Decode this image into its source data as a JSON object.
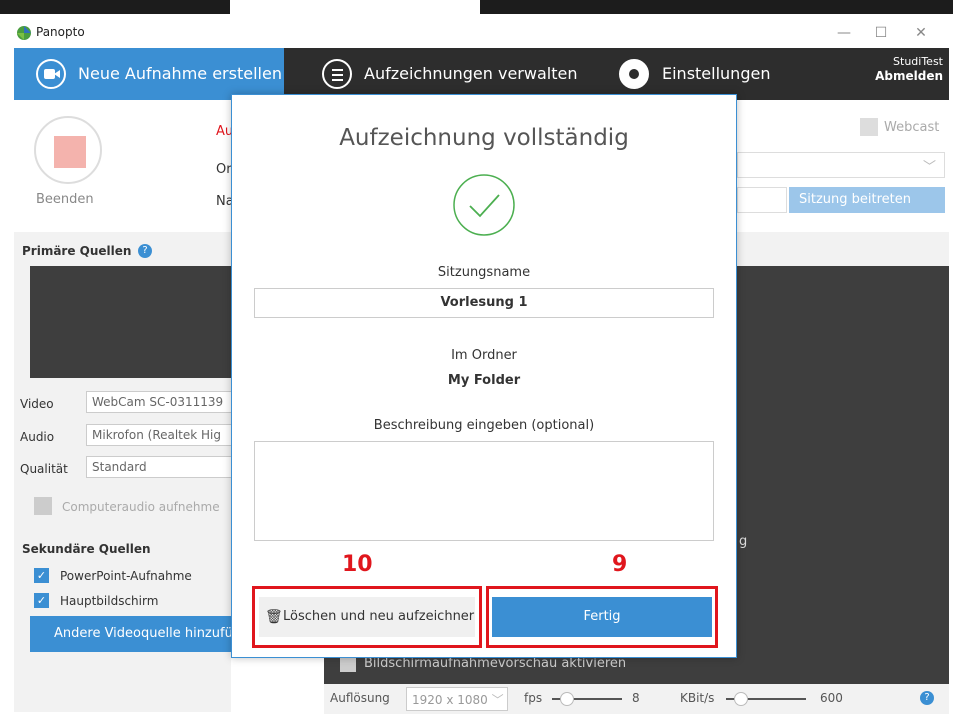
{
  "window": {
    "title": "Panopto",
    "minimize": "—",
    "maximize": "☐",
    "close": "✕"
  },
  "nav": {
    "new_recording": "Neue Aufnahme erstellen",
    "manage_recordings": "Aufzeichnungen verwalten",
    "settings": "Einstellungen",
    "user": "StudiTest",
    "logout": "Abmelden"
  },
  "record": {
    "stop_label": "Beenden",
    "partial_labels": [
      "Au",
      "Or",
      "Na"
    ]
  },
  "webcast": {
    "label": "Webcast"
  },
  "session": {
    "join_button": "Sitzung beitreten"
  },
  "primary": {
    "title": "Primäre Quellen",
    "video_label": "Video",
    "video_value": "WebCam SC-0311139",
    "audio_label": "Audio",
    "audio_value": "Mikrofon (Realtek Hig",
    "quality_label": "Qualität",
    "quality_value": "Standard",
    "computer_audio": "Computeraudio aufnehme"
  },
  "secondary": {
    "title": "Sekundäre Quellen",
    "items": [
      "PowerPoint-Aufnahme",
      "Hauptbildschirm"
    ],
    "add_button": "Andere Videoquelle hinzufü"
  },
  "right_partial": "g",
  "bottom": {
    "preview_label": "Bildschirmaufnahmevorschau aktivieren",
    "resolution_label": "Auflösung",
    "resolution_value": "1920 x 1080",
    "fps_label": "fps",
    "fps_value": "8",
    "kbit_label": "KBit/s",
    "kbit_value": "600"
  },
  "modal": {
    "title": "Aufzeichnung vollständig",
    "session_name_label": "Sitzungsname",
    "session_name_value": "Vorlesung 1",
    "folder_label": "Im Ordner",
    "folder_value": "My Folder",
    "description_label": "Beschreibung eingeben (optional)",
    "description_value": "",
    "delete_button": "Löschen und neu aufzeichner",
    "done_button": "Fertig"
  },
  "annotations": {
    "delete_number": "10",
    "done_number": "9"
  },
  "colors": {
    "accent": "#3b8fd3",
    "annotation": "#e0161d",
    "dark": "#3e3e3e"
  }
}
